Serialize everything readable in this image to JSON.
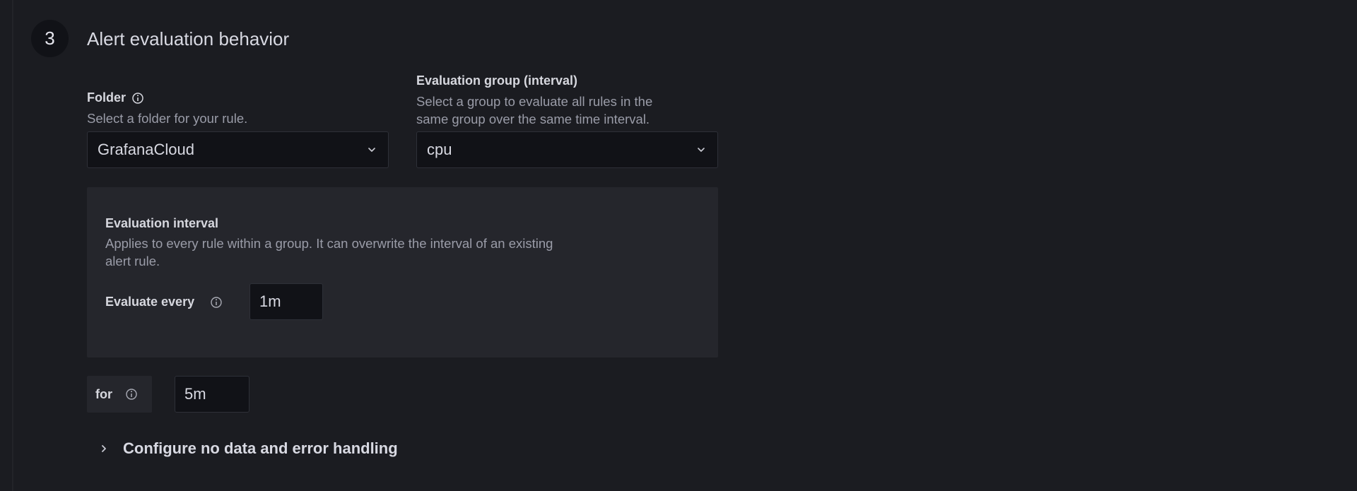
{
  "step": {
    "number": "3",
    "title": "Alert evaluation behavior"
  },
  "folder": {
    "label": "Folder",
    "description": "Select a folder for your rule.",
    "value": "GrafanaCloud",
    "info_icon": "info-circle-icon",
    "chevron_icon": "chevron-down-icon"
  },
  "evaluation_group": {
    "label": "Evaluation group (interval)",
    "description_line1": "Select a group to evaluate all rules in the",
    "description_line2": "same group over the same time interval.",
    "value": "cpu",
    "chevron_icon": "chevron-down-icon"
  },
  "evaluation_interval": {
    "title": "Evaluation interval",
    "description_line1": "Applies to every rule within a group. It can overwrite the interval of an existing",
    "description_line2": "alert rule.",
    "evaluate_every_label": "Evaluate every",
    "evaluate_every_value": "1m",
    "info_icon": "info-circle-icon"
  },
  "pending_period": {
    "label": "for",
    "value": "5m",
    "info_icon": "info-circle-icon"
  },
  "no_data_section": {
    "label": "Configure no data and error handling",
    "chevron_icon": "chevron-right-icon"
  },
  "colors": {
    "background": "#1b1c21",
    "input_background": "#111217",
    "panel_background": "#25262c",
    "text_primary": "#d8d9e2",
    "text_secondary": "#9a9ca8"
  }
}
